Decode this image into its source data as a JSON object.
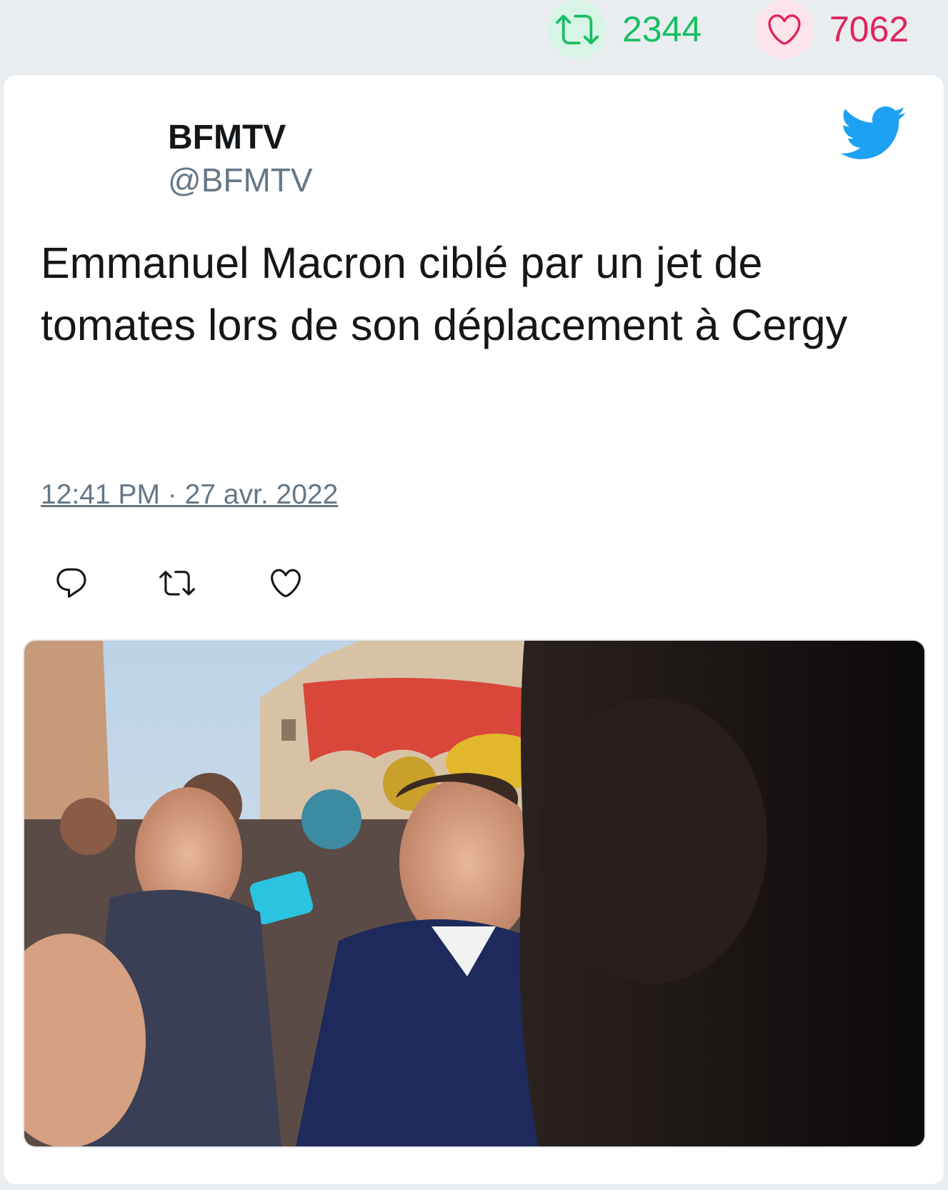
{
  "stats": {
    "retweet_icon": "retweet-icon",
    "retweets": "2344",
    "like_icon": "heart-icon",
    "likes": "7062"
  },
  "tweet": {
    "display_name": "BFMTV",
    "handle": "@BFMTV",
    "text": "Emmanuel Macron ciblé par un jet de tomates lors de son déplacement à Cergy",
    "timestamp": "12:41 PM · 27 avr. 2022"
  },
  "icons": {
    "brand": "twitter-bird-icon",
    "reply": "reply-icon",
    "retweet": "retweet-icon",
    "like": "heart-icon"
  },
  "colors": {
    "background": "#e9edf0",
    "retweet_green": "#17bf63",
    "like_red": "#e0245e",
    "twitter_blue": "#1da1f2",
    "secondary_text": "#657786"
  }
}
